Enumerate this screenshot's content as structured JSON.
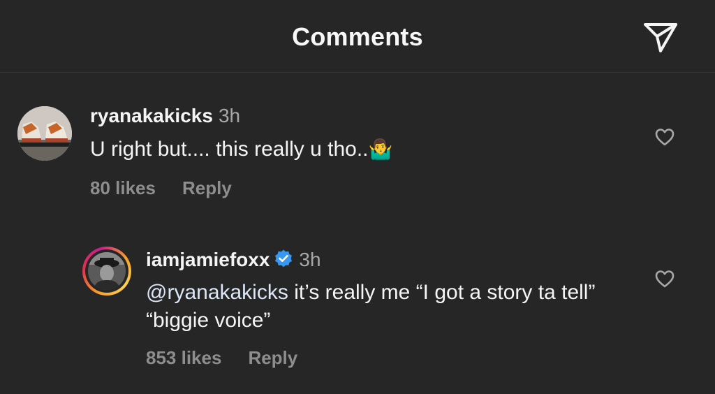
{
  "header": {
    "title": "Comments"
  },
  "comments": [
    {
      "username": "ryanakakicks",
      "time": "3h",
      "text": "U right but.... this really u tho..",
      "emoji": "🤷‍♂️",
      "likes": "80 likes",
      "reply_label": "Reply"
    },
    {
      "username": "iamjamiefoxx",
      "verified": true,
      "time": "3h",
      "mention": "@ryanakakicks",
      "text": " it’s really me “I got a story ta tell” “biggie voice”",
      "likes": "853 likes",
      "reply_label": "Reply"
    }
  ],
  "colors": {
    "background": "#262626",
    "verified_badge": "#3897f0",
    "mention": "#dbe6f6"
  },
  "icons": {
    "share": "paper-plane-icon",
    "like": "heart-outline-icon",
    "verified": "verified-badge-icon"
  }
}
